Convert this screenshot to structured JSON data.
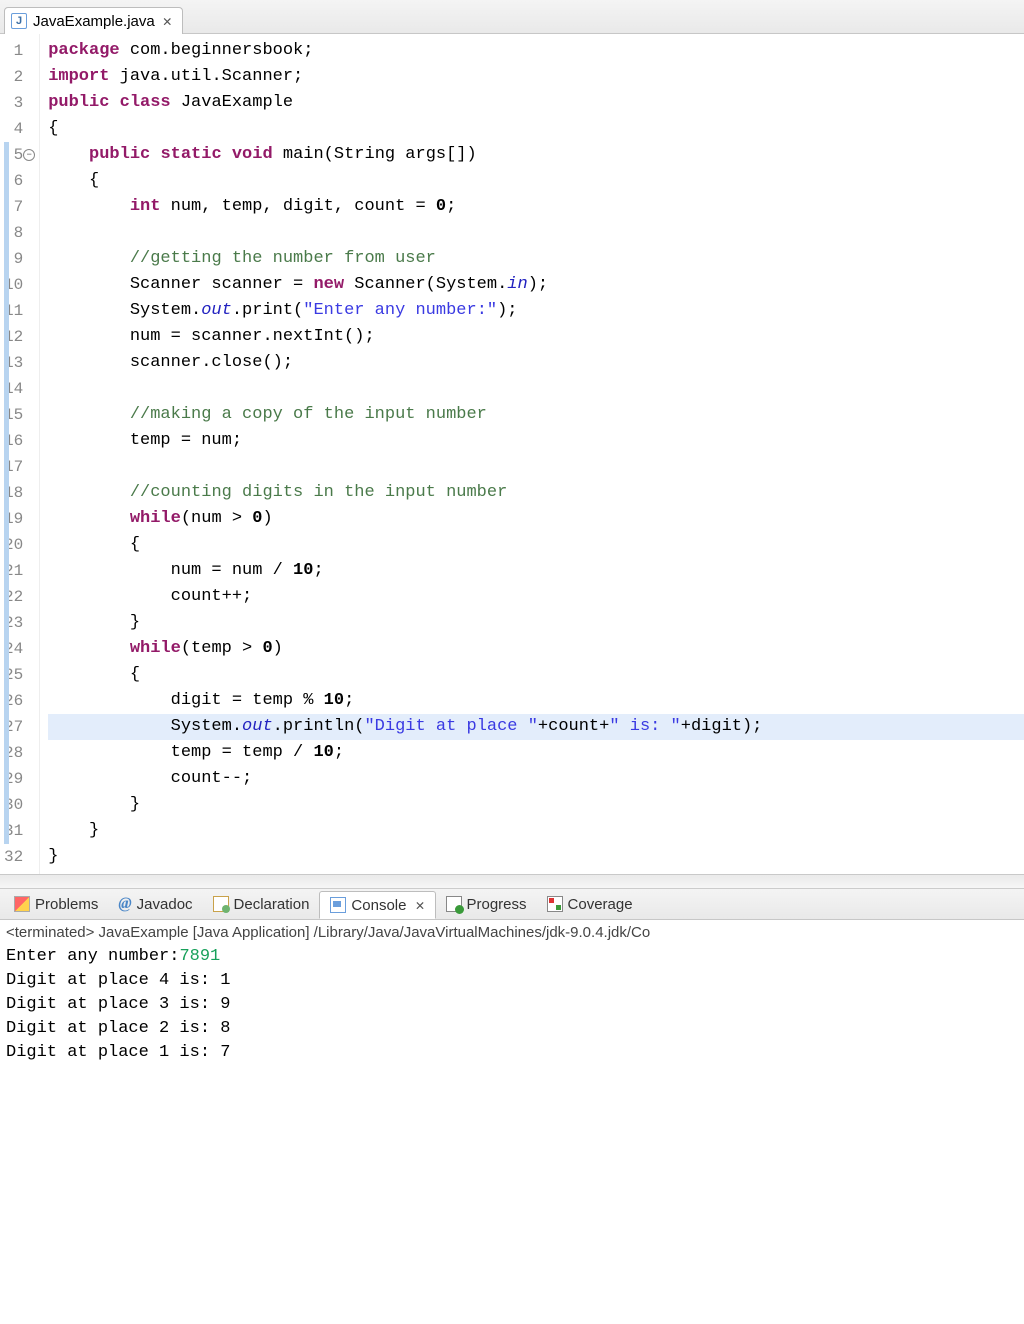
{
  "tab": {
    "filename": "JavaExample.java"
  },
  "code": {
    "lines": [
      {
        "n": 1,
        "marked": false,
        "hl": false,
        "tokens": [
          [
            "kw",
            "package"
          ],
          [
            "pkg",
            " com.beginnersbook;"
          ]
        ]
      },
      {
        "n": 2,
        "marked": false,
        "hl": false,
        "tokens": [
          [
            "kw",
            "import"
          ],
          [
            "pkg",
            " java.util.Scanner;"
          ]
        ]
      },
      {
        "n": 3,
        "marked": false,
        "hl": false,
        "tokens": [
          [
            "kw",
            "public"
          ],
          [
            "txt",
            " "
          ],
          [
            "kw",
            "class"
          ],
          [
            "txt",
            " JavaExample"
          ]
        ]
      },
      {
        "n": 4,
        "marked": false,
        "hl": false,
        "tokens": [
          [
            "txt",
            "{"
          ]
        ]
      },
      {
        "n": 5,
        "marked": true,
        "hl": false,
        "fold": true,
        "tokens": [
          [
            "txt",
            "    "
          ],
          [
            "kw",
            "public"
          ],
          [
            "txt",
            " "
          ],
          [
            "kw",
            "static"
          ],
          [
            "txt",
            " "
          ],
          [
            "kw",
            "void"
          ],
          [
            "txt",
            " main(String args[])"
          ]
        ]
      },
      {
        "n": 6,
        "marked": true,
        "hl": false,
        "tokens": [
          [
            "txt",
            "    {"
          ]
        ]
      },
      {
        "n": 7,
        "marked": true,
        "hl": false,
        "tokens": [
          [
            "txt",
            "        "
          ],
          [
            "kw",
            "int"
          ],
          [
            "txt",
            " num, temp, digit, count = "
          ],
          [
            "num",
            "0"
          ],
          [
            "txt",
            ";"
          ]
        ]
      },
      {
        "n": 8,
        "marked": true,
        "hl": false,
        "tokens": [
          [
            "txt",
            ""
          ]
        ]
      },
      {
        "n": 9,
        "marked": true,
        "hl": false,
        "tokens": [
          [
            "txt",
            "        "
          ],
          [
            "cmt",
            "//getting the number from user"
          ]
        ]
      },
      {
        "n": 10,
        "marked": true,
        "hl": false,
        "tokens": [
          [
            "txt",
            "        Scanner scanner = "
          ],
          [
            "kw",
            "new"
          ],
          [
            "txt",
            " Scanner(System."
          ],
          [
            "field",
            "in"
          ],
          [
            "txt",
            ");"
          ]
        ]
      },
      {
        "n": 11,
        "marked": true,
        "hl": false,
        "tokens": [
          [
            "txt",
            "        System."
          ],
          [
            "field",
            "out"
          ],
          [
            "txt",
            ".print("
          ],
          [
            "str",
            "\"Enter any number:\""
          ],
          [
            "txt",
            ");"
          ]
        ]
      },
      {
        "n": 12,
        "marked": true,
        "hl": false,
        "tokens": [
          [
            "txt",
            "        num = scanner.nextInt();"
          ]
        ]
      },
      {
        "n": 13,
        "marked": true,
        "hl": false,
        "tokens": [
          [
            "txt",
            "        scanner.close();"
          ]
        ]
      },
      {
        "n": 14,
        "marked": true,
        "hl": false,
        "tokens": [
          [
            "txt",
            ""
          ]
        ]
      },
      {
        "n": 15,
        "marked": true,
        "hl": false,
        "tokens": [
          [
            "txt",
            "        "
          ],
          [
            "cmt",
            "//making a copy of the input number"
          ]
        ]
      },
      {
        "n": 16,
        "marked": true,
        "hl": false,
        "tokens": [
          [
            "txt",
            "        temp = num;"
          ]
        ]
      },
      {
        "n": 17,
        "marked": true,
        "hl": false,
        "tokens": [
          [
            "txt",
            ""
          ]
        ]
      },
      {
        "n": 18,
        "marked": true,
        "hl": false,
        "tokens": [
          [
            "txt",
            "        "
          ],
          [
            "cmt",
            "//counting digits in the input number"
          ]
        ]
      },
      {
        "n": 19,
        "marked": true,
        "hl": false,
        "tokens": [
          [
            "txt",
            "        "
          ],
          [
            "kw",
            "while"
          ],
          [
            "txt",
            "(num > "
          ],
          [
            "num",
            "0"
          ],
          [
            "txt",
            ")"
          ]
        ]
      },
      {
        "n": 20,
        "marked": true,
        "hl": false,
        "tokens": [
          [
            "txt",
            "        {"
          ]
        ]
      },
      {
        "n": 21,
        "marked": true,
        "hl": false,
        "tokens": [
          [
            "txt",
            "            num = num / "
          ],
          [
            "num",
            "10"
          ],
          [
            "txt",
            ";"
          ]
        ]
      },
      {
        "n": 22,
        "marked": true,
        "hl": false,
        "tokens": [
          [
            "txt",
            "            count++;"
          ]
        ]
      },
      {
        "n": 23,
        "marked": true,
        "hl": false,
        "tokens": [
          [
            "txt",
            "        }"
          ]
        ]
      },
      {
        "n": 24,
        "marked": true,
        "hl": false,
        "tokens": [
          [
            "txt",
            "        "
          ],
          [
            "kw",
            "while"
          ],
          [
            "txt",
            "(temp > "
          ],
          [
            "num",
            "0"
          ],
          [
            "txt",
            ")"
          ]
        ]
      },
      {
        "n": 25,
        "marked": true,
        "hl": false,
        "tokens": [
          [
            "txt",
            "        {"
          ]
        ]
      },
      {
        "n": 26,
        "marked": true,
        "hl": false,
        "tokens": [
          [
            "txt",
            "            digit = temp % "
          ],
          [
            "num",
            "10"
          ],
          [
            "txt",
            ";"
          ]
        ]
      },
      {
        "n": 27,
        "marked": true,
        "hl": true,
        "tokens": [
          [
            "txt",
            "            System."
          ],
          [
            "field",
            "out"
          ],
          [
            "txt",
            ".println("
          ],
          [
            "str",
            "\"Digit at place \""
          ],
          [
            "txt",
            "+count+"
          ],
          [
            "str",
            "\" is: \""
          ],
          [
            "txt",
            "+digit);"
          ]
        ]
      },
      {
        "n": 28,
        "marked": true,
        "hl": false,
        "tokens": [
          [
            "txt",
            "            temp = temp / "
          ],
          [
            "num",
            "10"
          ],
          [
            "txt",
            ";"
          ]
        ]
      },
      {
        "n": 29,
        "marked": true,
        "hl": false,
        "tokens": [
          [
            "txt",
            "            count--;"
          ]
        ]
      },
      {
        "n": 30,
        "marked": true,
        "hl": false,
        "tokens": [
          [
            "txt",
            "        }"
          ]
        ]
      },
      {
        "n": 31,
        "marked": true,
        "hl": false,
        "tokens": [
          [
            "txt",
            "    }"
          ]
        ]
      },
      {
        "n": 32,
        "marked": false,
        "hl": false,
        "tokens": [
          [
            "txt",
            "}"
          ]
        ]
      }
    ]
  },
  "bottom_tabs": [
    {
      "id": "problems",
      "label": "Problems",
      "active": false
    },
    {
      "id": "javadoc",
      "label": "Javadoc",
      "active": false
    },
    {
      "id": "declaration",
      "label": "Declaration",
      "active": false
    },
    {
      "id": "console",
      "label": "Console",
      "active": true
    },
    {
      "id": "progress",
      "label": "Progress",
      "active": false
    },
    {
      "id": "coverage",
      "label": "Coverage",
      "active": false
    }
  ],
  "console": {
    "status": "<terminated> JavaExample [Java Application] /Library/Java/JavaVirtualMachines/jdk-9.0.4.jdk/Co",
    "prompt": "Enter any number:",
    "user_input": "7891",
    "output_lines": [
      "Digit at place 4 is: 1",
      "Digit at place 3 is: 9",
      "Digit at place 2 is: 8",
      "Digit at place 1 is: 7"
    ]
  }
}
